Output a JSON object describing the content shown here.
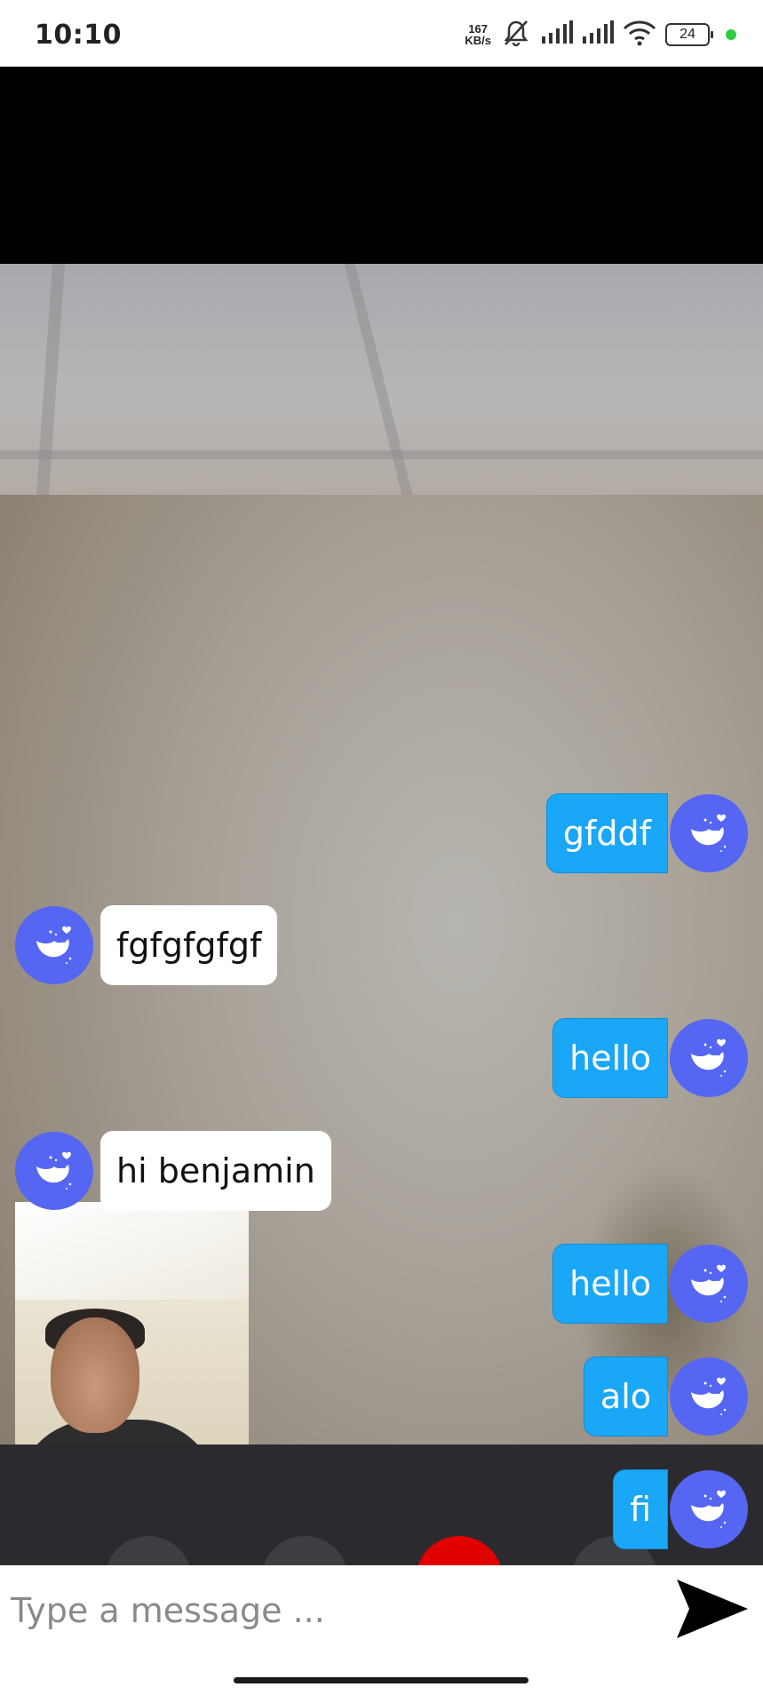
{
  "status_bar": {
    "time": "10:10",
    "net_speed_value": "167",
    "net_speed_unit": "KB/s",
    "battery": "24",
    "icons": [
      "mute-bell-icon",
      "signal-icon",
      "signal-icon",
      "wifi-icon",
      "battery-icon",
      "green-dot"
    ]
  },
  "chat": {
    "messages": [
      {
        "side": "right",
        "text": "gfddf"
      },
      {
        "side": "left",
        "text": "fgfgfgfgf"
      },
      {
        "side": "right",
        "text": "hello"
      },
      {
        "side": "left",
        "text": "hi benjamin"
      },
      {
        "side": "right",
        "text": "hello"
      },
      {
        "side": "right",
        "text": "alo"
      },
      {
        "side": "right",
        "text": "fi"
      }
    ]
  },
  "input": {
    "placeholder": "Type a message ...",
    "value": ""
  },
  "colors": {
    "avatar": "#5566f3",
    "outgoing_bubble": "#1aa7f7",
    "incoming_bubble": "#ffffff",
    "end_call": "#e00000"
  }
}
